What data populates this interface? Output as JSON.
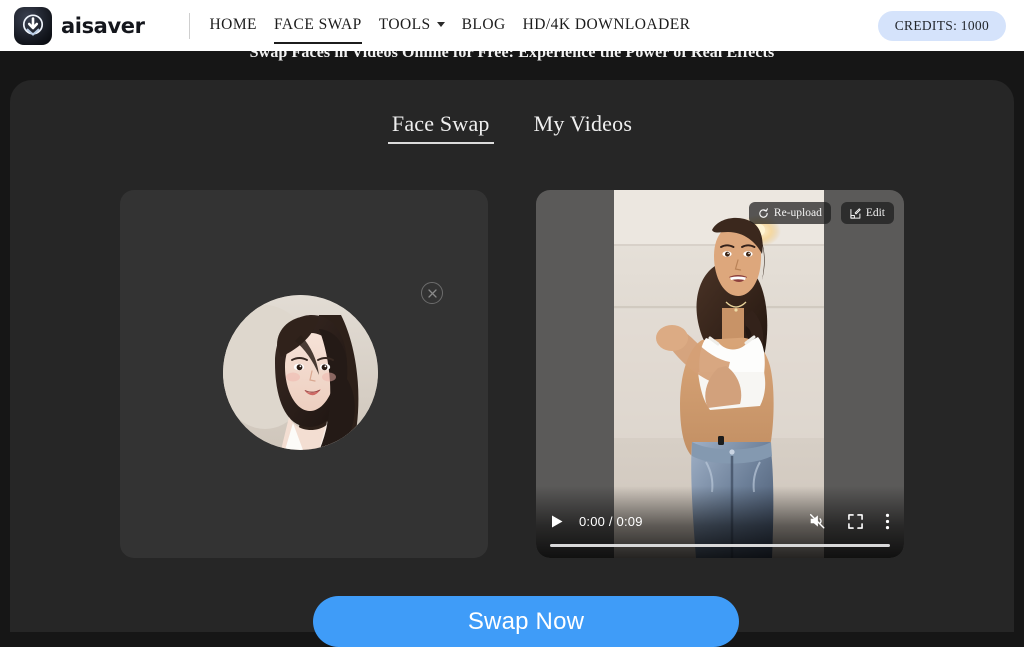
{
  "brand": {
    "name": "aisaver",
    "logo_icon": "download-arrow-icon"
  },
  "header": {
    "nav": [
      {
        "label": "HOME",
        "active": false,
        "caret": false
      },
      {
        "label": "FACE SWAP",
        "active": true,
        "caret": false
      },
      {
        "label": "TOOLS",
        "active": false,
        "caret": true
      },
      {
        "label": "BLOG",
        "active": false,
        "caret": false
      },
      {
        "label": "HD/4K DOWNLOADER",
        "active": false,
        "caret": false
      }
    ],
    "credits_label": "CREDITS: 1000",
    "credits_bg": "#d5e3fb"
  },
  "page": {
    "heading": "Swap Faces in Videos Online for Free: Experience the Power of Real Effects"
  },
  "tabs": [
    {
      "label": "Face Swap",
      "active": true
    },
    {
      "label": "My Videos",
      "active": false
    }
  ],
  "upload_panel": {
    "name": "source-face-upload",
    "remove_icon": "close-circle-icon",
    "has_image": true
  },
  "video_panel": {
    "reupload_label": "Re-upload",
    "reupload_icon": "refresh-icon",
    "edit_label": "Edit",
    "edit_icon": "pencil-edit-icon",
    "player": {
      "play_icon": "play-icon",
      "time": "0:00 / 0:09",
      "current_time": "0:00",
      "duration": "0:09",
      "mute_icon": "volume-muted-icon",
      "fullscreen_icon": "fullscreen-icon",
      "more_icon": "kebab-menu-icon",
      "progress_percent": 0
    }
  },
  "action": {
    "swap_label": "Swap Now",
    "swap_color": "#3f9cf8"
  },
  "colors": {
    "page_bg": "#161616",
    "card_bg": "#262626",
    "upload_bg": "#333333",
    "video_bg": "#5b5a59"
  }
}
